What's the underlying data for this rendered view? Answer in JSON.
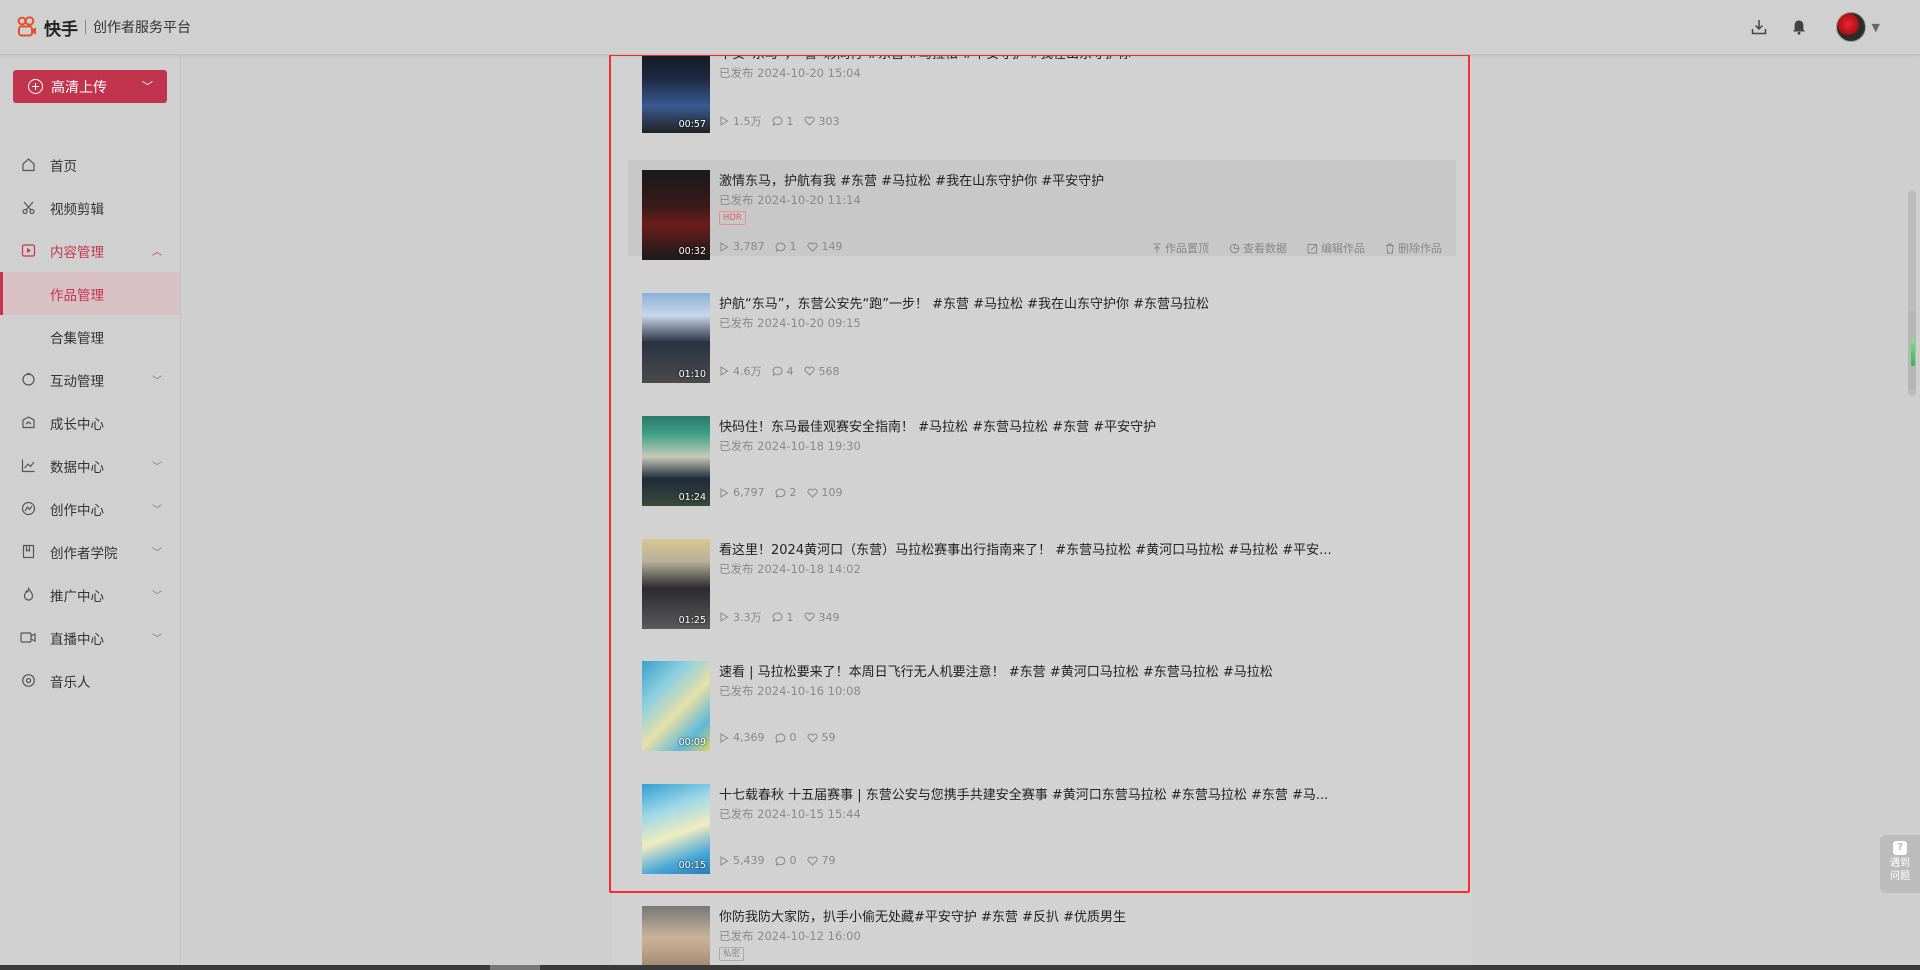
{
  "header": {
    "brand": "快手",
    "subtitle": "创作者服务平台",
    "icons": [
      "download-icon",
      "bell-icon",
      "avatar",
      "chevron-down-icon"
    ]
  },
  "sidebar": {
    "upload_label": "高清上传",
    "items": [
      {
        "label": "首页",
        "icon": "home-icon"
      },
      {
        "label": "视频剪辑",
        "icon": "scissors-icon"
      },
      {
        "label": "内容管理",
        "icon": "play-square-icon",
        "expanded": true
      },
      {
        "label": "作品管理",
        "sub": true,
        "selected": true
      },
      {
        "label": "合集管理",
        "sub": true
      },
      {
        "label": "互动管理",
        "icon": "interaction-icon"
      },
      {
        "label": "成长中心",
        "icon": "growth-icon"
      },
      {
        "label": "数据中心",
        "icon": "chart-icon"
      },
      {
        "label": "创作中心",
        "icon": "create-icon"
      },
      {
        "label": "创作者学院",
        "icon": "book-icon"
      },
      {
        "label": "推广中心",
        "icon": "fire-icon"
      },
      {
        "label": "直播中心",
        "icon": "live-icon"
      },
      {
        "label": "音乐人",
        "icon": "music-icon"
      }
    ]
  },
  "works": [
    {
      "title": "平安“东马”，“警”彩同行 #东营 #马拉松 #平安守护 #我在山东守护你",
      "date": "已发布 2024-10-20 15:04",
      "duration": "00:57",
      "plays": "1.5万",
      "comments": "1",
      "likes": "303"
    },
    {
      "title": "激情东马，护航有我 #东营 #马拉松 #我在山东守护你 #平安守护",
      "date": "已发布 2024-10-20 11:14",
      "duration": "00:32",
      "tag": "HDR",
      "plays": "3,787",
      "comments": "1",
      "likes": "149",
      "actions": [
        "作品置顶",
        "查看数据",
        "编辑作品",
        "删除作品"
      ]
    },
    {
      "title": "护航“东马”，东营公安先“跑”一步！ #东营 #马拉松 #我在山东守护你 #东营马拉松",
      "date": "已发布 2024-10-20 09:15",
      "duration": "01:10",
      "plays": "4.6万",
      "comments": "4",
      "likes": "568"
    },
    {
      "title": "快码住！东马最佳观赛安全指南！ #马拉松 #东营马拉松 #东营 #平安守护",
      "date": "已发布 2024-10-18 19:30",
      "duration": "01:24",
      "plays": "6,797",
      "comments": "2",
      "likes": "109"
    },
    {
      "title": "看这里！2024黄河口（东营）马拉松赛事出行指南来了！ #东营马拉松 #黄河口马拉松 #马拉松 #平安...",
      "date": "已发布 2024-10-18 14:02",
      "duration": "01:25",
      "plays": "3.3万",
      "comments": "1",
      "likes": "349"
    },
    {
      "title": "速看 | 马拉松要来了！本周日飞行无人机要注意！ #东营 #黄河口马拉松 #东营马拉松 #马拉松",
      "date": "已发布 2024-10-16 10:08",
      "duration": "00:09",
      "plays": "4,369",
      "comments": "0",
      "likes": "59"
    },
    {
      "title": "十七载春秋 十五届赛事 | 东营公安与您携手共建安全赛事 #黄河口东营马拉松 #东营马拉松 #东营 #马...",
      "date": "已发布 2024-10-15 15:44",
      "duration": "00:15",
      "plays": "5,439",
      "comments": "0",
      "likes": "79"
    },
    {
      "title": "你防我防大家防，扒手小偷无处藏#平安守护 #东营 #反扒 #优质男生",
      "date": "已发布 2024-10-12 16:00",
      "tag": "私密"
    }
  ],
  "help": {
    "line1": "遇到",
    "line2": "问题"
  },
  "colors": {
    "accent": "#c8334f",
    "highlight": "#ff2a2a"
  }
}
